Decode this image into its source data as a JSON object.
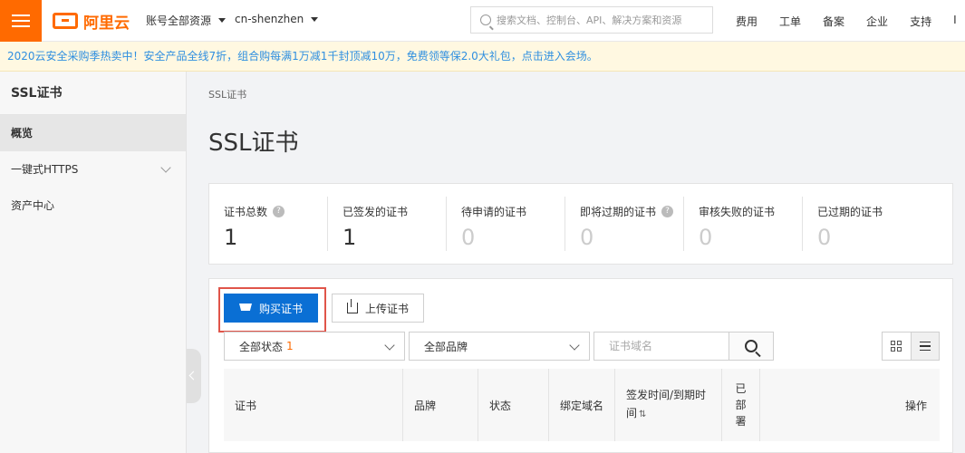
{
  "topbar": {
    "logo_text": "阿里云",
    "account_dropdown": "账号全部资源",
    "region_dropdown": "cn-shenzhen",
    "search_placeholder": "搜索文档、控制台、API、解决方案和资源",
    "links": [
      "费用",
      "工单",
      "备案",
      "企业",
      "支持",
      "I"
    ]
  },
  "banner": {
    "text": "2020云安全采购季热卖中！安全产品全线7折，组合购每满1万减1千封顶减10万，免费领等保2.0大礼包，点击进入会场。"
  },
  "sidebar": {
    "title": "SSL证书",
    "items": [
      {
        "label": "概览",
        "active": true
      },
      {
        "label": "一键式HTTPS",
        "expandable": true
      },
      {
        "label": "资产中心"
      }
    ]
  },
  "main": {
    "breadcrumb": "SSL证书",
    "title": "SSL证书",
    "stats": [
      {
        "label": "证书总数",
        "value": "1",
        "help": true
      },
      {
        "label": "已签发的证书",
        "value": "1"
      },
      {
        "label": "待申请的证书",
        "value": "0"
      },
      {
        "label": "即将过期的证书",
        "value": "0",
        "help": true
      },
      {
        "label": "审核失败的证书",
        "value": "0"
      },
      {
        "label": "已过期的证书",
        "value": "0"
      }
    ],
    "buy_button": "购买证书",
    "upload_button": "上传证书",
    "status_filter": {
      "label": "全部状态",
      "count": "1"
    },
    "brand_filter": "全部品牌",
    "domain_placeholder": "证书域名",
    "table_headers": [
      "证书",
      "品牌",
      "状态",
      "绑定域名",
      "签发时间/到期时间",
      "已部署",
      "操作"
    ],
    "help_glyph": "?",
    "sort_glyph": "⇅"
  },
  "colors": {
    "brand": "#ff6a00",
    "primary": "#0a6fd4",
    "highlight": "#e0554a"
  }
}
